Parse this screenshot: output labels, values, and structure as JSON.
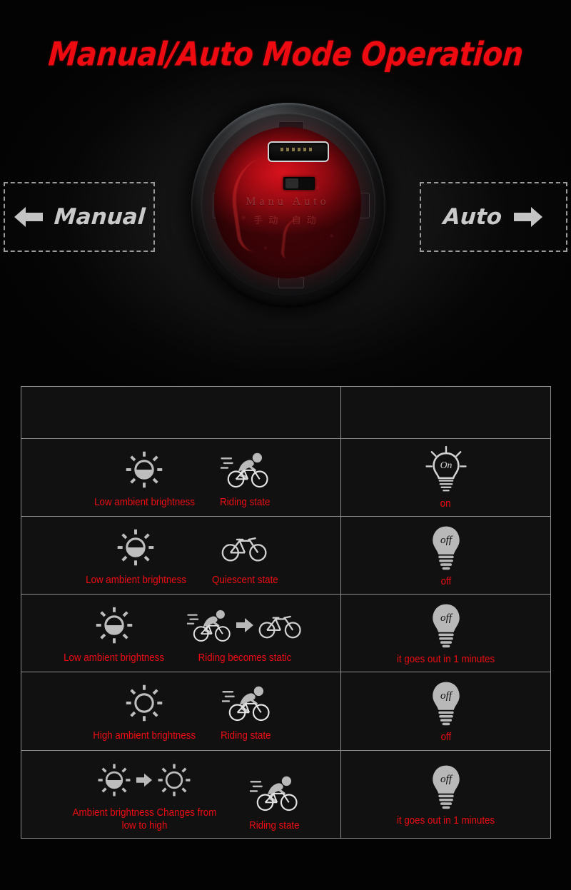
{
  "page": {
    "title": "Manual/Auto Mode Operation",
    "accent_red": "#ef0c13",
    "icon_gray": "#bdbdbd",
    "background": "#060606"
  },
  "modes": {
    "left": {
      "label": "Manual",
      "arrow": "arrow-left-icon"
    },
    "right": {
      "label": "Auto",
      "arrow": "arrow-right-icon"
    }
  },
  "product": {
    "name": "bike-taillight",
    "lens_text_primary": "Manu   Auto",
    "lens_text_secondary": "手动   自动"
  },
  "table": {
    "header": {
      "condition": "",
      "result": ""
    },
    "rows": [
      {
        "brightness_icon": "sun-low-icon",
        "brightness_label": "Low ambient brightness",
        "activity_icon": "cyclist-riding-icon",
        "activity_label": "Riding state",
        "result_icon": "bulb-on-icon",
        "result_icon_text": "On",
        "result_label": "on"
      },
      {
        "brightness_icon": "sun-low-icon",
        "brightness_label": "Low ambient brightness",
        "activity_icon": "bicycle-idle-icon",
        "activity_label": "Quiescent state",
        "result_icon": "bulb-off-icon",
        "result_icon_text": "off",
        "result_label": "off"
      },
      {
        "brightness_icon": "sun-low-icon",
        "brightness_label": "Low ambient brightness",
        "activity_icon": "cyclist-to-bicycle-icon",
        "activity_label": "Riding becomes static",
        "result_icon": "bulb-off-icon",
        "result_icon_text": "off",
        "result_label": "it goes out in 1 minutes"
      },
      {
        "brightness_icon": "sun-high-icon",
        "brightness_label": "High ambient brightness",
        "activity_icon": "cyclist-riding-icon",
        "activity_label": "Riding state",
        "result_icon": "bulb-off-icon",
        "result_icon_text": "off",
        "result_label": "off"
      },
      {
        "brightness_icon": "sun-low-to-high-icon",
        "brightness_label": "Ambient brightness Changes from low to high",
        "activity_icon": "cyclist-riding-icon",
        "activity_label": "Riding state",
        "result_icon": "bulb-off-icon",
        "result_icon_text": "off",
        "result_label": "it goes out in 1 minutes"
      }
    ]
  }
}
